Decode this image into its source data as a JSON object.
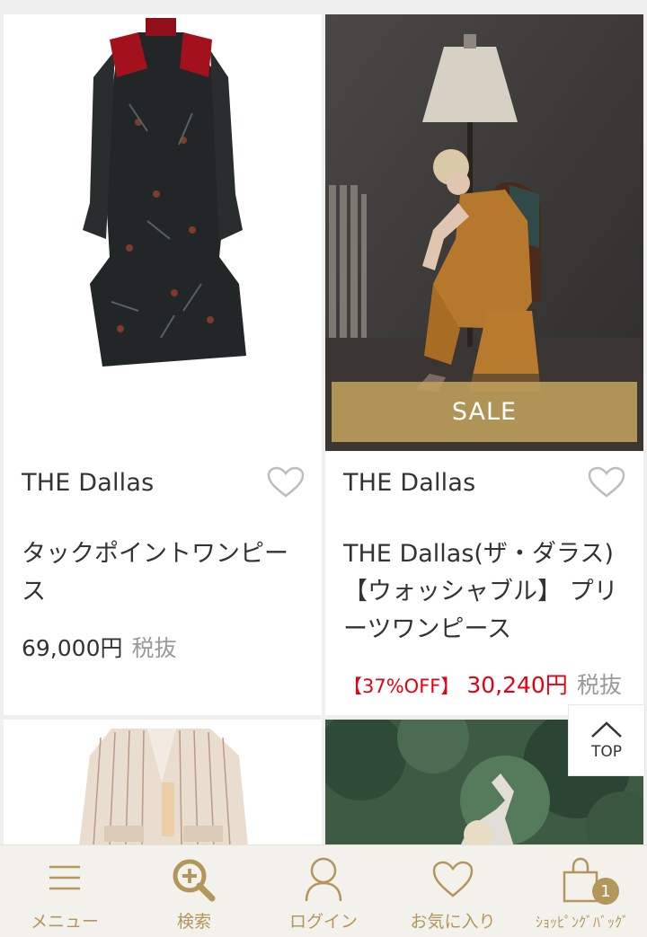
{
  "products": [
    {
      "brand": "THE Dallas",
      "name": "タックポイントワンピース",
      "price": "69,000円",
      "tax": "税抜"
    },
    {
      "brand": "THE Dallas",
      "name": "THE Dallas(ザ・ダラス)【ウォッシャブル】 プリーツワンピース",
      "badge": "SALE",
      "discount": "【37%OFF】",
      "price": "30,240円",
      "tax": "税抜"
    }
  ],
  "top_button": {
    "label": "TOP"
  },
  "tabbar": {
    "menu": "メニュー",
    "search": "検索",
    "login": "ログイン",
    "favorites": "お気に入り",
    "bag": "ｼｮｯﾋﾟﾝｸﾞﾊﾞｯｸﾞ",
    "bag_count": "1"
  },
  "colors": {
    "gold": "#b3975a",
    "sale_red": "#e60012",
    "tax_gray": "#9a9a9a"
  }
}
